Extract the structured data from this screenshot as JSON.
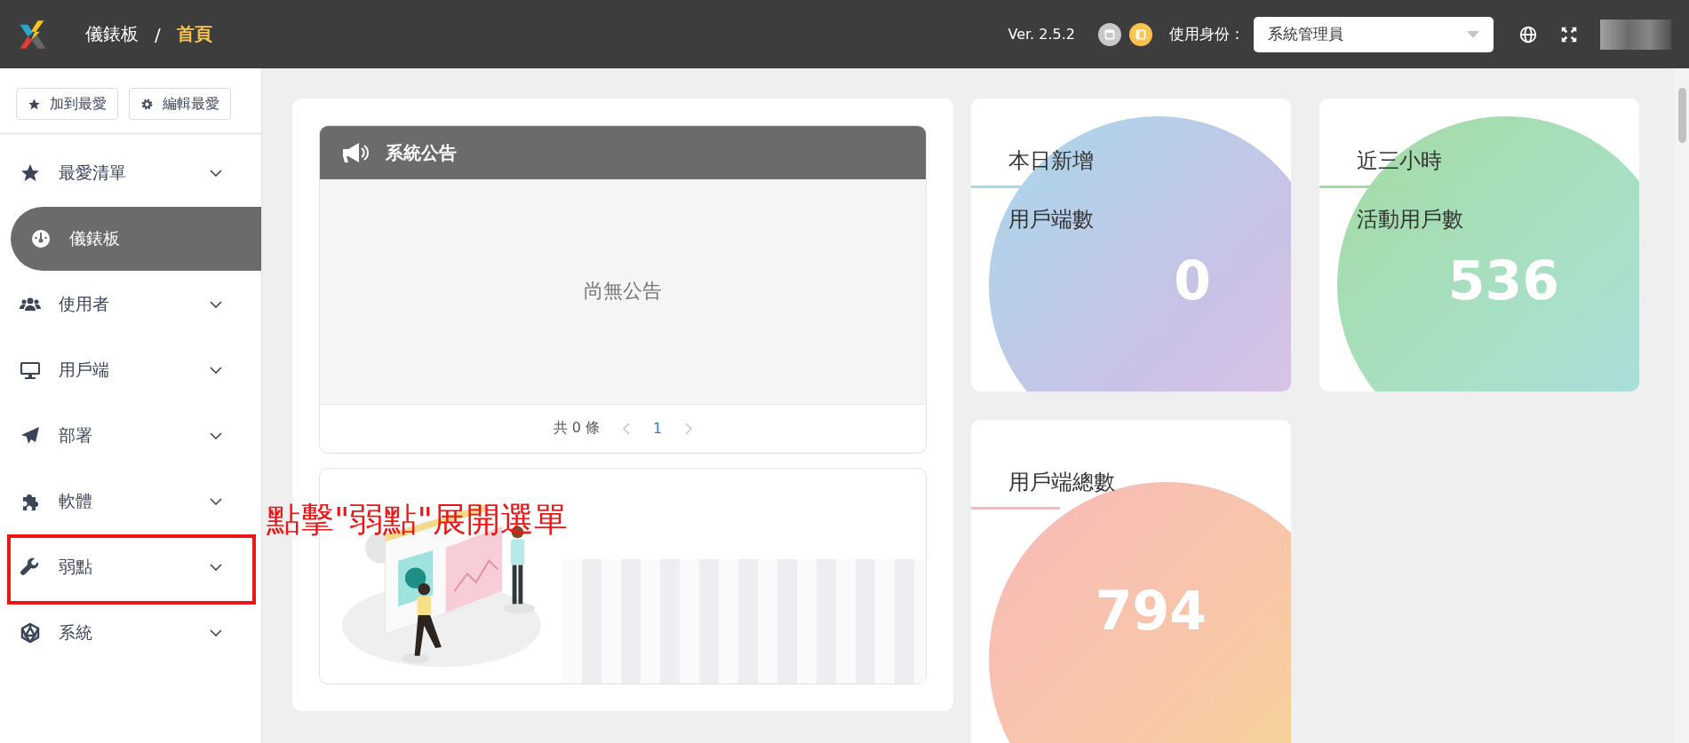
{
  "header": {
    "breadcrumb": [
      "儀錶板",
      "/",
      "首頁"
    ],
    "version": "Ver. 2.5.2",
    "identity_label": "使用身份：",
    "identity_select": {
      "value": "系統管理員"
    }
  },
  "sidebar": {
    "buttons": [
      "加到最愛",
      "編輯最愛"
    ],
    "items": [
      {
        "label": "最愛清單",
        "kind": "group",
        "selected": false
      },
      {
        "label": "儀錶板",
        "kind": "link",
        "selected": true
      },
      {
        "label": "使用者",
        "kind": "group",
        "selected": false
      },
      {
        "label": "用戶端",
        "kind": "group",
        "selected": false
      },
      {
        "label": "部署",
        "kind": "group",
        "selected": false
      },
      {
        "label": "軟體",
        "kind": "group",
        "selected": false
      },
      {
        "label": "弱點",
        "kind": "group",
        "selected": false
      },
      {
        "label": "系統",
        "kind": "group",
        "selected": false
      }
    ]
  },
  "announcement": {
    "title": "系統公告",
    "empty_text": "尚無公告",
    "pager": {
      "total": "共 0 條",
      "pages": [
        {
          "label": "1",
          "selected": true
        }
      ]
    }
  },
  "stats": [
    {
      "titles": [
        "本日新增",
        "用戶端數"
      ],
      "value": "0"
    },
    {
      "titles": [
        "近三小時",
        "活動用戶數"
      ],
      "value": "536"
    },
    {
      "titles": [
        "用戶端總數"
      ],
      "value": "794"
    }
  ],
  "annotation": {
    "text": "點擊\"弱點\"展開選單"
  }
}
